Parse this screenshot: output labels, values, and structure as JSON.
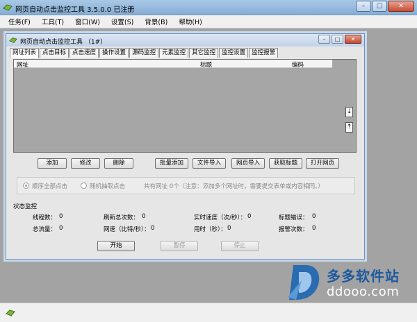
{
  "window": {
    "title": "网页自动点击监控工具 3.5.0.0 已注册",
    "close_label": "✕",
    "min_label": "–",
    "max_label": "□"
  },
  "menu": [
    "任务(F)",
    "工具(T)",
    "窗口(W)",
    "设置(S)",
    "背景(B)",
    "帮助(H)"
  ],
  "child": {
    "title": "网页自动点击监控工具 （1#）"
  },
  "tabs": [
    "网址列表",
    "点击目标",
    "点击速度",
    "操作设置",
    "源码监控",
    "元素监控",
    "其它监控",
    "监控设置",
    "监控报警"
  ],
  "list": {
    "columns": [
      "网址",
      "标题",
      "编码"
    ],
    "scroll_down": "⇣",
    "scroll_up": "⇡"
  },
  "buttons": {
    "add": "添加",
    "edit": "修改",
    "delete": "删除",
    "batch_add": "批量添加",
    "file_import": "文件导入",
    "web_import": "网页导入",
    "get_title": "获取标题",
    "open_page": "打开网页",
    "start": "开始",
    "pause": "暂停",
    "stop": "停止"
  },
  "options": {
    "sequential": "顺序全部点击",
    "random": "随机抽取点击",
    "note": "共有网址  0个（注意：添加多个网址时，需要提交表单或内容相同。）"
  },
  "status": {
    "heading": "状态监控",
    "items": [
      {
        "label": "线程数：",
        "value": "0"
      },
      {
        "label": "刷新总次数：",
        "value": "0"
      },
      {
        "label": "实时速度（次/秒）：",
        "value": "0"
      },
      {
        "label": "标题错误：",
        "value": "0"
      },
      {
        "label": "总流量：",
        "value": "0"
      },
      {
        "label": "网速（比特/秒）：",
        "value": "0"
      },
      {
        "label": "用时（秒）：",
        "value": "0"
      },
      {
        "label": "报警次数：",
        "value": "0"
      }
    ]
  },
  "watermark": {
    "name": "多多软件站",
    "url": "ddooo.com"
  }
}
